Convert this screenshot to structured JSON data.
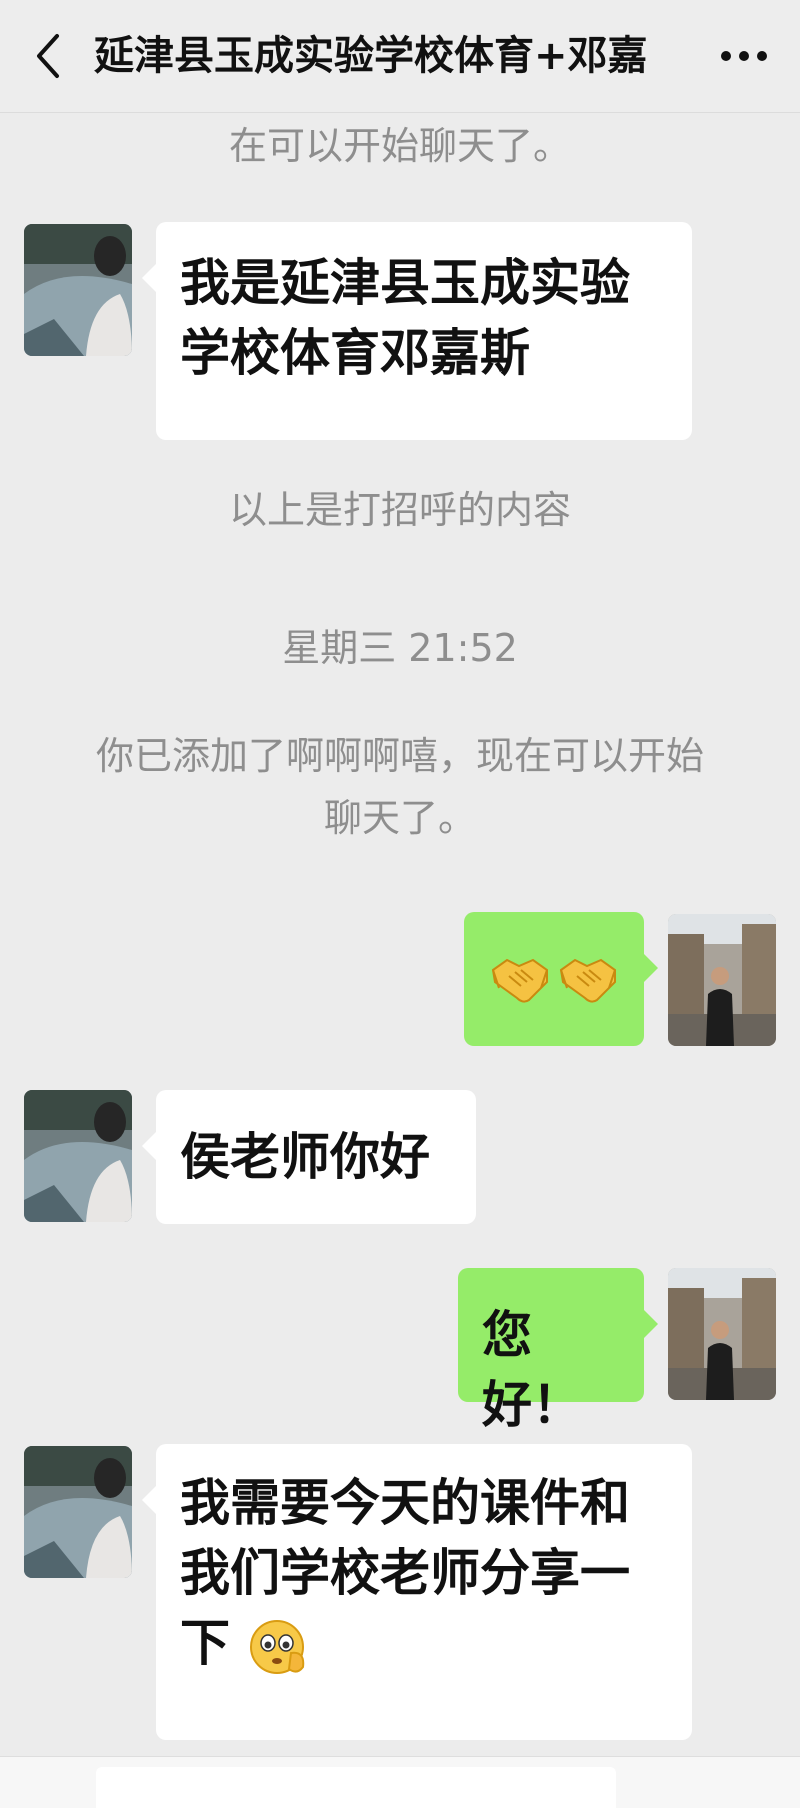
{
  "header": {
    "title": "延津县玉成实验学校体育+邓嘉",
    "back_icon": "chevron-left-icon",
    "more_icon": "more-dots-icon"
  },
  "system_messages": {
    "top_partial": "在可以开始聊天了。",
    "greeting_note": "以上是打招呼的内容",
    "timestamp": "星期三 21:52",
    "added_line1": "你已添加了啊啊啊嘻，现在可以开始",
    "added_line2": "聊天了。"
  },
  "messages": [
    {
      "side": "left",
      "lines": [
        "我是延津县玉成实验",
        "学校体育邓嘉斯"
      ]
    },
    {
      "side": "right",
      "emoji": "handshake-emoji",
      "count": 2
    },
    {
      "side": "left",
      "lines": [
        "侯老师你好"
      ]
    },
    {
      "side": "right",
      "lines": [
        "您好！"
      ]
    },
    {
      "side": "left",
      "lines": [
        "我需要今天的课件和",
        "我们学校老师分享一",
        "下"
      ],
      "emoji": "pleading-face-hand-emoji"
    }
  ],
  "colors": {
    "background": "#ececec",
    "left_bubble": "#ffffff",
    "right_bubble": "#95ec69",
    "system_text": "#8e8e8e"
  }
}
